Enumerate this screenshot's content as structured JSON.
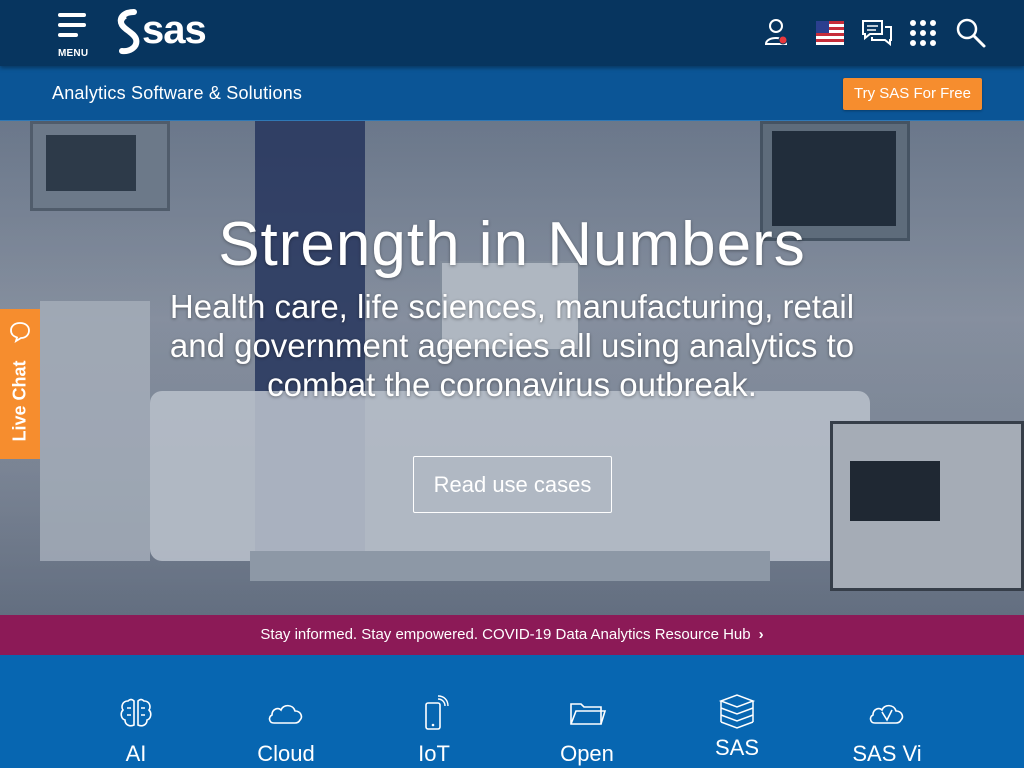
{
  "header": {
    "menu_label": "MENU",
    "logo_text": "sas",
    "icons": [
      "account-icon",
      "us-flag-icon",
      "chat-bubbles-icon",
      "apps-grid-icon",
      "search-icon"
    ]
  },
  "subbar": {
    "title": "Analytics Software & Solutions",
    "cta": "Try SAS For Free"
  },
  "hero": {
    "title": "Strength in Numbers",
    "subtitle": "Health care, life sciences, manufacturing, retail and government agencies all using analytics to combat the coronavirus outbreak.",
    "button": "Read use cases"
  },
  "live_chat": {
    "label": "Live Chat"
  },
  "banner": {
    "text": "Stay informed. Stay empowered. COVID-19 Data Analytics Resource Hub",
    "chevron": "›"
  },
  "features": [
    {
      "label": "AI",
      "icon": "brain-icon"
    },
    {
      "label": "Cloud",
      "icon": "cloud-icon"
    },
    {
      "label": "IoT",
      "icon": "phone-signal-icon"
    },
    {
      "label": "Open",
      "icon": "folder-icon"
    },
    {
      "label": "SAS",
      "icon": "stack-icon"
    },
    {
      "label": "SAS Vi",
      "icon": "cloud-check-icon"
    }
  ],
  "colors": {
    "topbar": "#07355f",
    "subbar": "#0b5596",
    "accent_orange": "#f68d2e",
    "banner": "#8c1a57",
    "features_bg": "#0766b1"
  }
}
